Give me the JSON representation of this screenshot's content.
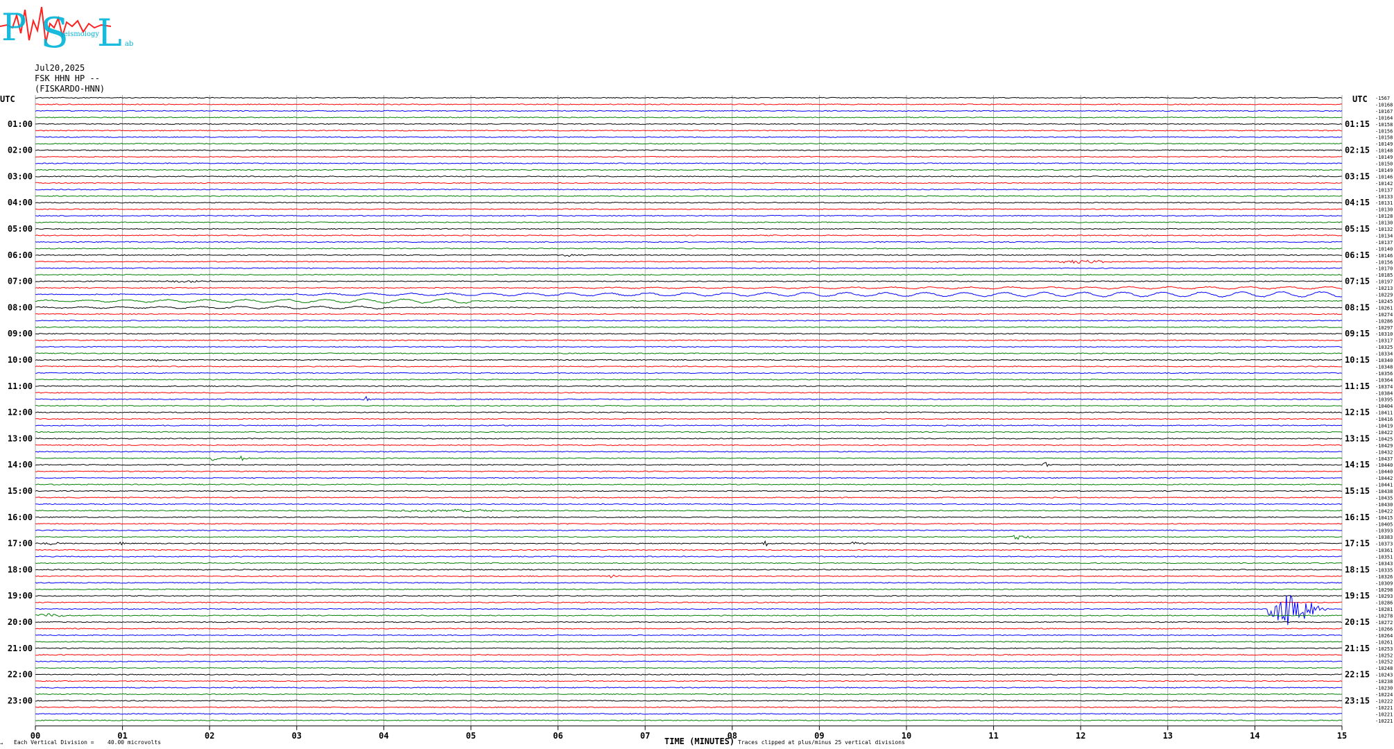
{
  "header": {
    "date": "Jul20,2025",
    "station": "FSK HHN HP --",
    "station_name": "(FISKARDO-HNN)"
  },
  "logo": {
    "text_P": "P",
    "text_S": "S",
    "text_L": "L",
    "text_eismology": "eismology",
    "text_ab": "ab"
  },
  "footer": {
    "scale_label": "Each Vertical Division =",
    "scale_value": "40.00 microvolts",
    "clip_note": "Traces clipped at plus/minus 25 vertical divisions",
    "corner_mark": "→"
  },
  "colors": {
    "trace_cycle": [
      "#000000",
      "#ff0000",
      "#0000ff",
      "#008000"
    ],
    "logo_cyan": "#00b4d8",
    "logo_red": "#ff2020"
  },
  "chart_data": {
    "type": "line",
    "title": "",
    "xlabel": "TIME (MINUTES)",
    "ylabel": "",
    "xlim": [
      0,
      15
    ],
    "x_ticks": [
      "00",
      "01",
      "02",
      "03",
      "04",
      "05",
      "06",
      "07",
      "08",
      "09",
      "10",
      "11",
      "12",
      "13",
      "14",
      "15"
    ],
    "trace_minutes": 15,
    "trace_count": 96,
    "left_axis_title": "UTC",
    "right_axis_title": "UTC",
    "left_hour_labels": [
      "01:00",
      "02:00",
      "03:00",
      "04:00",
      "05:00",
      "06:00",
      "07:00",
      "08:00",
      "09:00",
      "10:00",
      "11:00",
      "12:00",
      "13:00",
      "14:00",
      "15:00",
      "16:00",
      "17:00",
      "18:00",
      "19:00",
      "20:00",
      "21:00",
      "22:00",
      "23:00"
    ],
    "right_hour_labels": [
      "01:15",
      "02:15",
      "03:15",
      "04:15",
      "05:15",
      "06:15",
      "07:15",
      "08:15",
      "09:15",
      "10:15",
      "11:15",
      "12:15",
      "13:15",
      "14:15",
      "15:15",
      "16:15",
      "17:15",
      "18:15",
      "19:15",
      "20:15",
      "21:15",
      "22:15",
      "23:15"
    ],
    "trace_offsets": [
      "-1567",
      "-10168",
      "-10167",
      "-10164",
      "-10158",
      "-10156",
      "-10158",
      "-10149",
      "-10148",
      "-10149",
      "-10150",
      "-10149",
      "-10146",
      "-10142",
      "-10137",
      "-10133",
      "-10131",
      "-10130",
      "-10128",
      "-10130",
      "-10132",
      "-10134",
      "-10137",
      "-10140",
      "-10146",
      "-10156",
      "-10170",
      "-10185",
      "-10197",
      "-10213",
      "-10229",
      "-10245",
      "-10261",
      "-10274",
      "-10286",
      "-10297",
      "-10310",
      "-10317",
      "-10325",
      "-10334",
      "-10340",
      "-10348",
      "-10356",
      "-10364",
      "-10374",
      "-10384",
      "-10395",
      "-10404",
      "-10411",
      "-10416",
      "-10419",
      "-10422",
      "-10425",
      "-10429",
      "-10432",
      "-10437",
      "-10440",
      "-10440",
      "-10442",
      "-10441",
      "-10438",
      "-10435",
      "-10430",
      "-10422",
      "-10415",
      "-10405",
      "-10393",
      "-10383",
      "-10373",
      "-10361",
      "-10351",
      "-10343",
      "-10335",
      "-10326",
      "-10309",
      "-10298",
      "-10293",
      "-10286",
      "-10281",
      "-10278",
      "-10272",
      "-10266",
      "-10264",
      "-10261",
      "-10253",
      "-10252",
      "-10252",
      "-10248",
      "-10243",
      "-10238",
      "-10230",
      "-10224",
      "-10222",
      "-10221",
      "-10221",
      "-10221"
    ],
    "events": [
      {
        "trace": 24,
        "start_min": 6.05,
        "end_min": 6.45,
        "peak_div": 1.2
      },
      {
        "trace": 25,
        "start_min": 8.85,
        "end_min": 9.05,
        "peak_div": 0.8
      },
      {
        "trace": 25,
        "start_min": 10.25,
        "end_min": 10.5,
        "peak_div": 0.9
      },
      {
        "trace": 25,
        "start_min": 11.6,
        "end_min": 12.9,
        "peak_div": 1.1
      },
      {
        "trace": 28,
        "start_min": 1.5,
        "end_min": 2.4,
        "peak_div": 0.7
      },
      {
        "trace": 29,
        "start_min": 6.0,
        "end_min": 15.0,
        "peak_div": 0.8
      },
      {
        "trace": 30,
        "start_min": 3.0,
        "end_min": 15.0,
        "peak_div": 1.9
      },
      {
        "trace": 31,
        "start_min": 0.0,
        "end_min": 5.0,
        "peak_div": 1.6
      },
      {
        "trace": 32,
        "start_min": 0.0,
        "end_min": 4.0,
        "peak_div": 1.0
      },
      {
        "trace": 40,
        "start_min": 1.3,
        "end_min": 1.6,
        "peak_div": 0.9
      },
      {
        "trace": 46,
        "start_min": 3.15,
        "end_min": 3.4,
        "peak_div": 1.2
      },
      {
        "trace": 46,
        "start_min": 3.75,
        "end_min": 3.9,
        "peak_div": 2.2
      },
      {
        "trace": 55,
        "start_min": 2.0,
        "end_min": 2.15,
        "peak_div": 3.0
      },
      {
        "trace": 55,
        "start_min": 2.3,
        "end_min": 2.6,
        "peak_div": 2.0
      },
      {
        "trace": 56,
        "start_min": 11.55,
        "end_min": 11.7,
        "peak_div": 2.2
      },
      {
        "trace": 56,
        "start_min": 12.4,
        "end_min": 12.5,
        "peak_div": 1.0
      },
      {
        "trace": 63,
        "start_min": 4.0,
        "end_min": 6.5,
        "peak_div": 0.9
      },
      {
        "trace": 67,
        "start_min": 11.2,
        "end_min": 11.6,
        "peak_div": 2.2
      },
      {
        "trace": 68,
        "start_min": 0.0,
        "end_min": 0.5,
        "peak_div": 1.0
      },
      {
        "trace": 68,
        "start_min": 0.95,
        "end_min": 1.1,
        "peak_div": 1.8
      },
      {
        "trace": 68,
        "start_min": 8.3,
        "end_min": 8.5,
        "peak_div": 2.6
      },
      {
        "trace": 68,
        "start_min": 9.3,
        "end_min": 9.7,
        "peak_div": 1.0
      },
      {
        "trace": 73,
        "start_min": 6.55,
        "end_min": 6.8,
        "peak_div": 0.9
      },
      {
        "trace": 78,
        "start_min": 14.15,
        "end_min": 15.0,
        "peak_div": 14.0
      },
      {
        "trace": 79,
        "start_min": 0.0,
        "end_min": 0.6,
        "peak_div": 1.4
      }
    ]
  }
}
